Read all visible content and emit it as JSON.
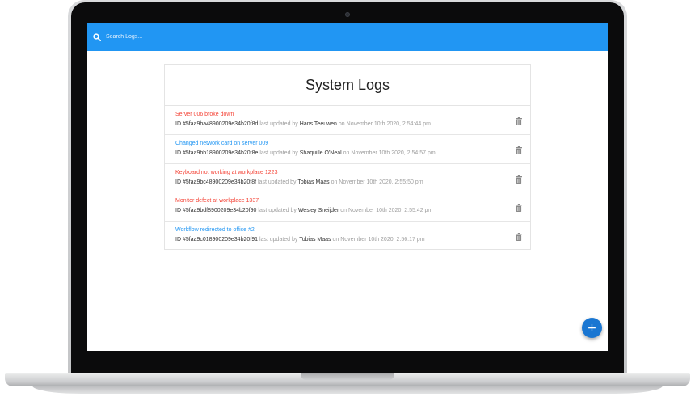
{
  "search": {
    "placeholder": "Search Logs..."
  },
  "page": {
    "title": "System Logs"
  },
  "logs": [
    {
      "message": "Server 006 broke down",
      "status": "attention",
      "id_text": "ID #5faa9ba48900209e34b20f8d",
      "updated_by_label": "last updated by",
      "tech": "Hans Teeuwen",
      "date_text": "on November 10th 2020, 2:54:44 pm"
    },
    {
      "message": "Changed network card on server 009",
      "status": "normal",
      "id_text": "ID #5faa9bb18900209e34b20f8e",
      "updated_by_label": "last updated by",
      "tech": "Shaquille O'Neal",
      "date_text": "on November 10th 2020, 2:54:57 pm"
    },
    {
      "message": "Keyboard not working at workplace 1223",
      "status": "attention",
      "id_text": "ID #5faa9bc48900209e34b20f8f",
      "updated_by_label": "last updated by",
      "tech": "Tobias Maas",
      "date_text": "on November 10th 2020, 2:55:50 pm"
    },
    {
      "message": "Monitor defect at workplace 1337",
      "status": "attention",
      "id_text": "ID #5faa9bdf8900209e34b20f90",
      "updated_by_label": "last updated by",
      "tech": "Wesley Sneijder",
      "date_text": "on November 10th 2020, 2:55:42 pm"
    },
    {
      "message": "Workflow redirected to office #2",
      "status": "normal",
      "id_text": "ID #5faa9c018900209e34b20f91",
      "updated_by_label": "last updated by",
      "tech": "Tobias Maas",
      "date_text": "on November 10th 2020, 2:56:17 pm"
    }
  ],
  "fab": {
    "symbol": "+",
    "icon": "add-icon"
  },
  "colors": {
    "nav": "#2196f3",
    "attention": "#f44336",
    "normal": "#2196f3",
    "fab": "#1976d2"
  }
}
